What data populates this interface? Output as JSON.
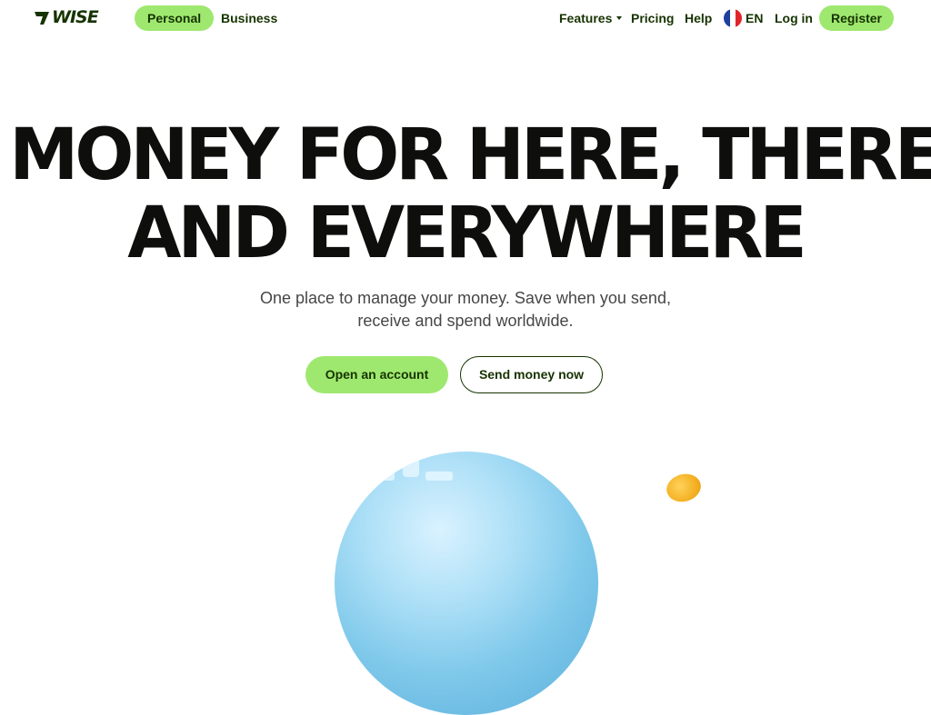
{
  "header": {
    "logo_text": "WISE",
    "tabs": [
      {
        "label": "Personal",
        "active": true
      },
      {
        "label": "Business",
        "active": false
      }
    ],
    "nav": {
      "features": "Features",
      "pricing": "Pricing",
      "help": "Help",
      "language": "EN",
      "login": "Log in",
      "register": "Register"
    }
  },
  "hero": {
    "title_line1": "MONEY FOR HERE, THERE",
    "title_line2": "AND EVERYWHERE",
    "subtitle_line1": "One place to manage your money. Save when you send,",
    "subtitle_line2": "receive and spend worldwide.",
    "cta_primary": "Open an account",
    "cta_secondary": "Send money now"
  },
  "colors": {
    "brand_green": "#9fe870",
    "forest_green": "#163300",
    "headline": "#0e0f0c",
    "subtext": "#454745"
  },
  "icons": {
    "logo": "wise-flag-icon",
    "features_caret": "chevron-down-icon",
    "language_flag": "france-flag-icon"
  }
}
